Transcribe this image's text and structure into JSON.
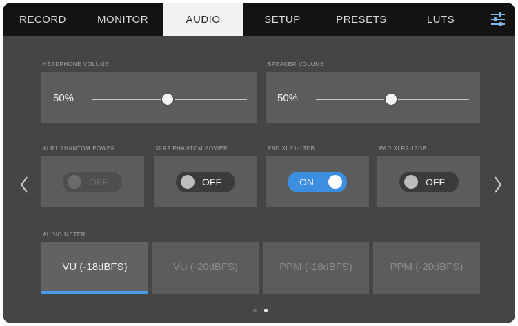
{
  "tabs": [
    {
      "label": "RECORD"
    },
    {
      "label": "MONITOR"
    },
    {
      "label": "AUDIO"
    },
    {
      "label": "SETUP"
    },
    {
      "label": "PRESETS"
    },
    {
      "label": "LUTS"
    }
  ],
  "active_tab": "AUDIO",
  "headphone_volume": {
    "label": "HEADPHONE VOLUME",
    "value_text": "50%",
    "level": 0.5
  },
  "speaker_volume": {
    "label": "SPEAKER VOLUME",
    "value_text": "50%",
    "level": 0.5
  },
  "toggles": [
    {
      "label": "XLR1 PHANTOM POWER",
      "state": "OFF",
      "on": false,
      "enabled": false
    },
    {
      "label": "XLR2 PHANTOM POWER",
      "state": "OFF",
      "on": false,
      "enabled": true
    },
    {
      "label": "PAD XLR1-13dB",
      "state": "ON",
      "on": true,
      "enabled": true
    },
    {
      "label": "PAD XLR2-13dB",
      "state": "OFF",
      "on": false,
      "enabled": true
    }
  ],
  "audio_meter": {
    "label": "AUDIO METER",
    "options": [
      "VU (-18dBFS)",
      "VU (-20dBFS)",
      "PPM (-18dBFS)",
      "PPM (-20dBFS)"
    ],
    "selected": "VU (-18dBFS)"
  },
  "pager": {
    "pages": 2,
    "current": 2
  },
  "colors": {
    "accent": "#3c8fe0",
    "background": "#454545",
    "tabbar": "#131313",
    "panel": "#5c5c5c"
  },
  "icons": {
    "settings": "sliders-icon",
    "prev": "chevron-left-icon",
    "next": "chevron-right-icon"
  }
}
